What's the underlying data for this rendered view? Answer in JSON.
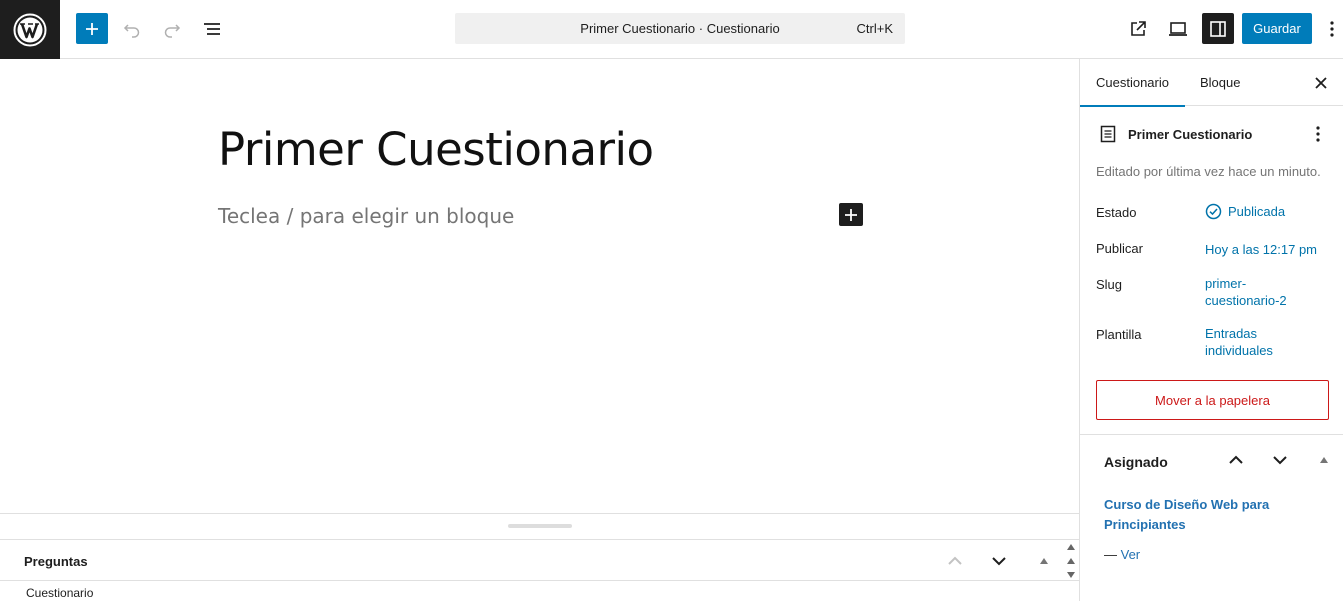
{
  "topbar": {
    "command_bar_text": "Primer Cuestionario · Cuestionario",
    "command_shortcut": "Ctrl+K",
    "save_label": "Guardar"
  },
  "editor": {
    "title": "Primer Cuestionario",
    "block_placeholder": "Teclea / para elegir un bloque"
  },
  "metabox": {
    "title": "Preguntas",
    "subtitle": "Cuestionario"
  },
  "sidebar": {
    "tabs": [
      {
        "label": "Cuestionario",
        "active": true
      },
      {
        "label": "Bloque",
        "active": false
      }
    ],
    "doc_title": "Primer Cuestionario",
    "last_edited": "Editado por última vez hace un minuto.",
    "rows": {
      "status": {
        "label": "Estado",
        "value": "Publicada"
      },
      "publish": {
        "label": "Publicar",
        "value": "Hoy a las 12:17 pm"
      },
      "slug": {
        "label": "Slug",
        "value_line1": "primer-",
        "value_line2": "cuestionario-2"
      },
      "template": {
        "label": "Plantilla",
        "value_line1": "Entradas",
        "value_line2": "individuales"
      }
    },
    "trash_label": "Mover a la papelera",
    "assigned": {
      "title": "Asignado",
      "course_line1": "Curso de Diseño Web para",
      "course_line2": "Principiantes",
      "view_prefix": "— ",
      "view_label": "Ver"
    }
  },
  "icons": {
    "logo": "wordpress-logo",
    "add": "plus-icon",
    "undo": "undo-icon",
    "redo": "redo-icon",
    "list_view": "list-view-icon",
    "view": "external-link-icon",
    "preview": "laptop-icon",
    "settings": "sidebar-toggle-icon",
    "more": "more-vertical-icon",
    "close": "close-icon",
    "document": "document-icon",
    "status": "check-circle-icon",
    "chevron_up": "chevron-up-icon",
    "chevron_down": "chevron-down-icon",
    "triangle_up": "triangle-up-icon"
  },
  "colors": {
    "accent": "#007cba",
    "link": "#2271b1",
    "danger": "#cc1818",
    "dark": "#1e1e1e"
  }
}
